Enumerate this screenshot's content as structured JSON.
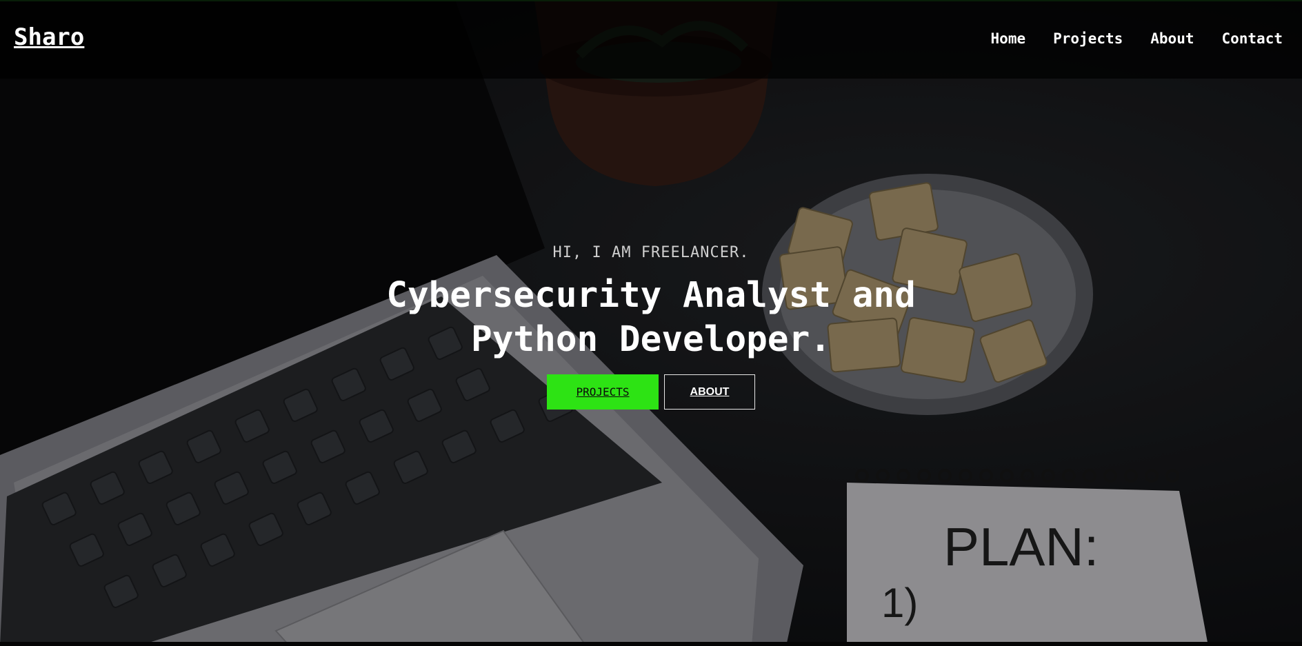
{
  "nav": {
    "brand": "Sharo",
    "links": [
      "Home",
      "Projects",
      "About",
      "Contact"
    ]
  },
  "hero": {
    "kicker": "HI, I AM FREELANCER.",
    "headline_line1": "Cybersecurity Analyst and",
    "headline_line2": "Python Developer.",
    "projects_button": "PROJECTS",
    "about_button": "ABOUT",
    "notepad_text": "PLAN:",
    "notepad_mark": "1)"
  },
  "colors": {
    "accent": "#2de314",
    "nav_background": "#000000",
    "text": "#ffffff"
  },
  "icons": [
    "laptop-image",
    "plant-pot-image",
    "crackers-plate-image",
    "notepad-image"
  ]
}
